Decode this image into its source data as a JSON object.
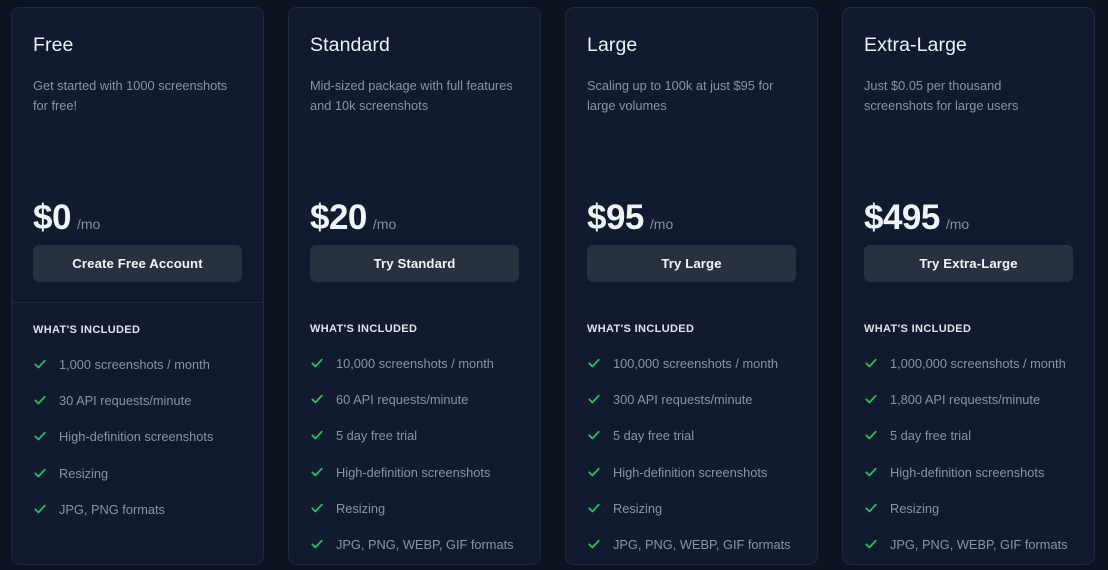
{
  "theme": {
    "page_background": "#0d1321",
    "card_background": "#111a2e",
    "card_border": "#1e2942",
    "button_background": "#28313f",
    "accent_check": "#22c55e",
    "title_color": "#eef2f8",
    "muted_text": "#8a93a6"
  },
  "included_label": "WHAT'S INCLUDED",
  "check_icon_name": "check-icon",
  "plans": [
    {
      "name": "Free",
      "description": "Get started with 1000 screenshots for free!",
      "price": "$0",
      "period": "/mo",
      "cta": "Create Free Account",
      "features": [
        "1,000 screenshots / month",
        "30 API requests/minute",
        "High-definition screenshots",
        "Resizing",
        "JPG, PNG formats"
      ]
    },
    {
      "name": "Standard",
      "description": "Mid-sized package with full features and 10k screenshots",
      "price": "$20",
      "period": "/mo",
      "cta": "Try Standard",
      "features": [
        "10,000 screenshots / month",
        "60 API requests/minute",
        "5 day free trial",
        "High-definition screenshots",
        "Resizing",
        "JPG, PNG, WEBP, GIF formats"
      ]
    },
    {
      "name": "Large",
      "description": "Scaling up to 100k at just $95 for large volumes",
      "price": "$95",
      "period": "/mo",
      "cta": "Try Large",
      "features": [
        "100,000 screenshots / month",
        "300 API requests/minute",
        "5 day free trial",
        "High-definition screenshots",
        "Resizing",
        "JPG, PNG, WEBP, GIF formats"
      ]
    },
    {
      "name": "Extra-Large",
      "description": "Just $0.05 per thousand screenshots for large users",
      "price": "$495",
      "period": "/mo",
      "cta": "Try Extra-Large",
      "features": [
        "1,000,000 screenshots / month",
        "1,800 API requests/minute",
        "5 day free trial",
        "High-definition screenshots",
        "Resizing",
        "JPG, PNG, WEBP, GIF formats"
      ]
    }
  ]
}
